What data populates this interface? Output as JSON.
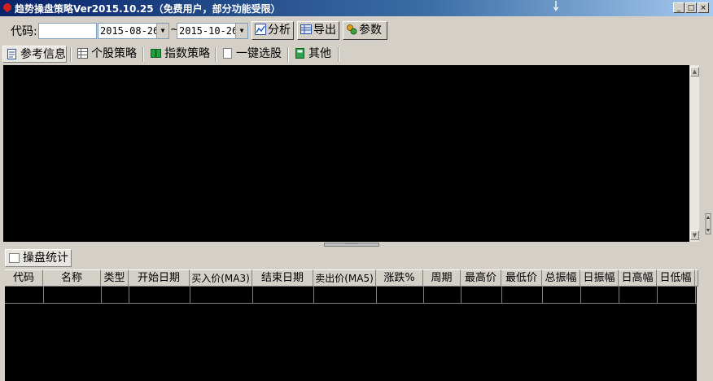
{
  "window": {
    "title": "趋势操盘策略Ver2015.10.25（免费用户，部分功能受限）",
    "min_label": "_",
    "max_label": "□",
    "close_label": "×"
  },
  "toolbar": {
    "code_label": "代码:",
    "code_value": "",
    "start_date": "2015-08-26",
    "tilde": "~",
    "end_date": "2015-10-26",
    "analyze_label": "分析",
    "export_label": "导出",
    "params_label": "参数"
  },
  "tabs": [
    {
      "label": "参考信息"
    },
    {
      "label": "个股策略"
    },
    {
      "label": "指数策略"
    },
    {
      "label": "一键选股"
    },
    {
      "label": "其他"
    }
  ],
  "bottom_tab": {
    "label": "操盘统计"
  },
  "grid": {
    "columns": [
      "代码",
      "名称",
      "类型",
      "开始日期",
      "买入价(MA3)",
      "结束日期",
      "卖出价(MA5)",
      "涨跌%",
      "周期",
      "最高价",
      "最低价",
      "总振幅",
      "日振幅",
      "日高幅",
      "日低幅"
    ]
  },
  "colors": {
    "title_bar": "#0a246a",
    "pane_background": "#000000",
    "chrome": "#d4d0c8"
  },
  "icons": {
    "scroll_up": "▲",
    "scroll_down": "▼",
    "combo_arrow": "▼",
    "grip": "··········"
  }
}
